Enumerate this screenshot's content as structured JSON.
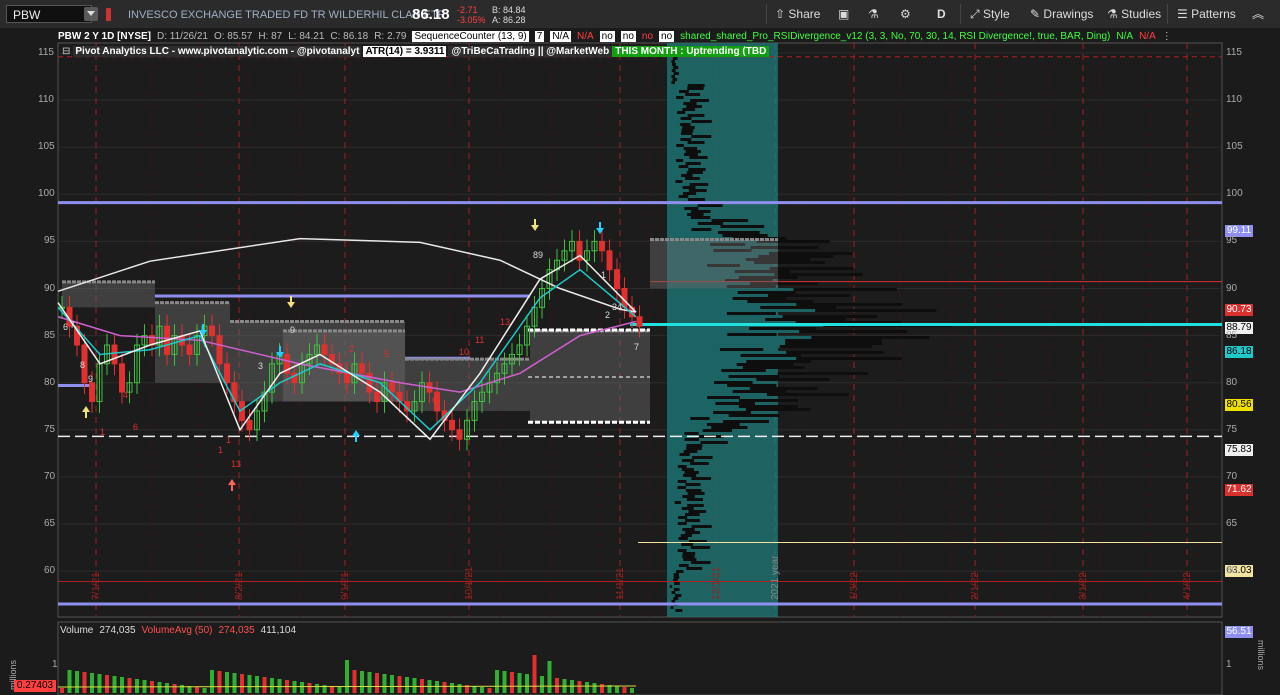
{
  "symbol": "PBW",
  "description": "INVESCO EXCHANGE TRADED FD TR WILDERHIL CLAN ETF",
  "last_price": "86.18",
  "change": "-2.71",
  "change_pct": "-3.05%",
  "bid": "B: 84.84",
  "ask": "A: 86.28",
  "toolbar": {
    "share": "Share",
    "style": "Style",
    "drawings": "Drawings",
    "studies": "Studies",
    "patterns": "Patterns",
    "d": "D"
  },
  "header": {
    "chart_id": "PBW 2 Y 1D [NYSE]",
    "date": "D: 11/26/21",
    "open": "O: 85.57",
    "high": "H: 87",
    "low": "L: 84.21",
    "close": "C: 86.18",
    "range": "R: 2.79",
    "seqcounter": "SequenceCounter (13, 9)",
    "seq7": "7",
    "na1": "N/A",
    "na2": "N/A",
    "no1": "no",
    "no2": "no",
    "no3": "no",
    "no4": "no",
    "rsi": "shared_shared_Pro_RSIDivergence_v12 (3, 3, No, 70, 30, 14, RSI Divergence!, true, BAR, Ding)",
    "na3": "N/A",
    "na4": "N/A"
  },
  "row2": {
    "pivot": "Pivot Analytics LLC - www.pivotanalytic.com - @pivotanalyt",
    "atr": "ATR(14) = 3.9311",
    "handles": "@TriBeCaTrading || @MarketWeb",
    "month": "THIS MONTH : Uptrending (TBD"
  },
  "price_labels": [
    {
      "text": "99.11",
      "value": 99.11,
      "color": "#8f8ff0"
    },
    {
      "text": "90.73",
      "value": 90.73,
      "color": "#d93030"
    },
    {
      "text": "88.79",
      "value": 88.79,
      "color": "#f0f0f0"
    },
    {
      "text": "86.18",
      "value": 86.18,
      "color": "#20c8c8"
    },
    {
      "text": "80.56",
      "value": 80.56,
      "color": "#f0e000"
    },
    {
      "text": "75.83",
      "value": 75.83,
      "color": "#f0f0f0"
    },
    {
      "text": "71.62",
      "value": 71.62,
      "color": "#d93030"
    },
    {
      "text": "63.03",
      "value": 63.03,
      "color": "#f3e3a0"
    },
    {
      "text": "56.51",
      "value": 56.51,
      "color": "#8f8ff0"
    }
  ],
  "y_axis_ticks": [
    "115",
    "110",
    "105",
    "100",
    "95",
    "90",
    "85",
    "80",
    "75",
    "70",
    "65",
    "60"
  ],
  "x_labels": [
    "7/1/21",
    "8/2/21",
    "9/1/21",
    "10/1/21",
    "11/1/21",
    "12/1/21",
    "2021 year",
    "1/3/22",
    "2/1/22",
    "3/1/22",
    "4/1/22"
  ],
  "volume": {
    "title": "Volume",
    "value": "274,035",
    "avg_label": "VolumeAvg (50)",
    "avg_value": "274,035",
    "avg_value2": "411,104",
    "left_unit": "millions",
    "right_unit": "millions",
    "tick": "1",
    "current_label": "0.27403"
  }
}
